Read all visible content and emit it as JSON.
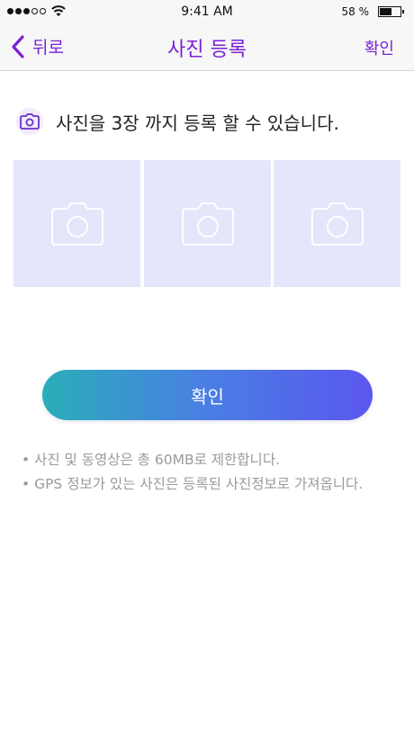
{
  "status_bar": {
    "time": "9:41 AM",
    "battery_text": "58 %",
    "battery_level": 0.58,
    "signal_bars_filled": 3,
    "signal_bars_total": 5
  },
  "nav": {
    "back_label": "뒤로",
    "title": "사진 등록",
    "confirm_label": "확인",
    "accent_color": "#7a22d8"
  },
  "info": {
    "text": "사진을 3장 까지 등록 할 수 있습니다.",
    "icon": "camera-icon"
  },
  "photo_slots": [
    {
      "icon": "camera-icon"
    },
    {
      "icon": "camera-icon"
    },
    {
      "icon": "camera-icon"
    }
  ],
  "confirm_button": {
    "label": "확인",
    "gradient": [
      "#2aaeb8",
      "#5b57ee"
    ]
  },
  "notes": [
    "• 사진 및 동영상은 총 60MB로 제한합니다.",
    "• GPS 정보가 있는 사진은 등록된 사진정보로 가져옵니다."
  ]
}
